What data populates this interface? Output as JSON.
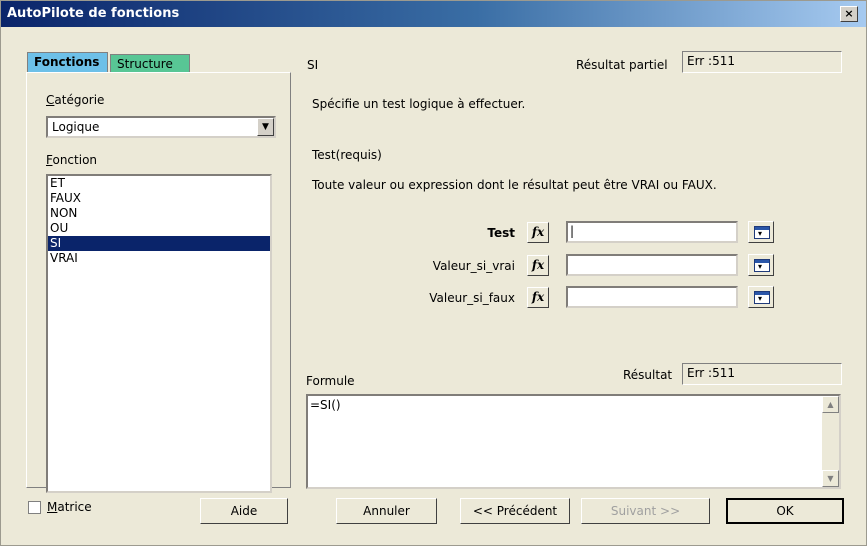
{
  "window": {
    "title": "AutoPilote de fonctions",
    "close": "×"
  },
  "tabs": [
    {
      "label": "Fonctions"
    },
    {
      "label": "Structure"
    }
  ],
  "left": {
    "category_label": "Catégorie",
    "category_value": "Logique",
    "function_label": "Fonction",
    "functions": [
      "ET",
      "FAUX",
      "NON",
      "OU",
      "SI",
      "VRAI"
    ],
    "selected_function": "SI"
  },
  "right": {
    "function_name": "SI",
    "partial_result_label": "Résultat partiel",
    "partial_result_value": "Err :511",
    "description": "Spécifie un test logique à effectuer.",
    "arg_title": "Test(requis)",
    "arg_description": "Toute valeur ou expression dont le résultat peut être VRAI ou FAUX.",
    "args": [
      {
        "label": "Test",
        "value": "|"
      },
      {
        "label": "Valeur_si_vrai",
        "value": ""
      },
      {
        "label": "Valeur_si_faux",
        "value": ""
      }
    ],
    "fx_symbol": "fx",
    "formula_label": "Formule",
    "result_label": "Résultat",
    "result_value": "Err :511",
    "formula_text": "=SI()"
  },
  "footer": {
    "matrix_label": "Matrice",
    "help": "Aide",
    "cancel": "Annuler",
    "previous": "<< Précédent",
    "next": "Suivant >>",
    "ok": "OK"
  }
}
